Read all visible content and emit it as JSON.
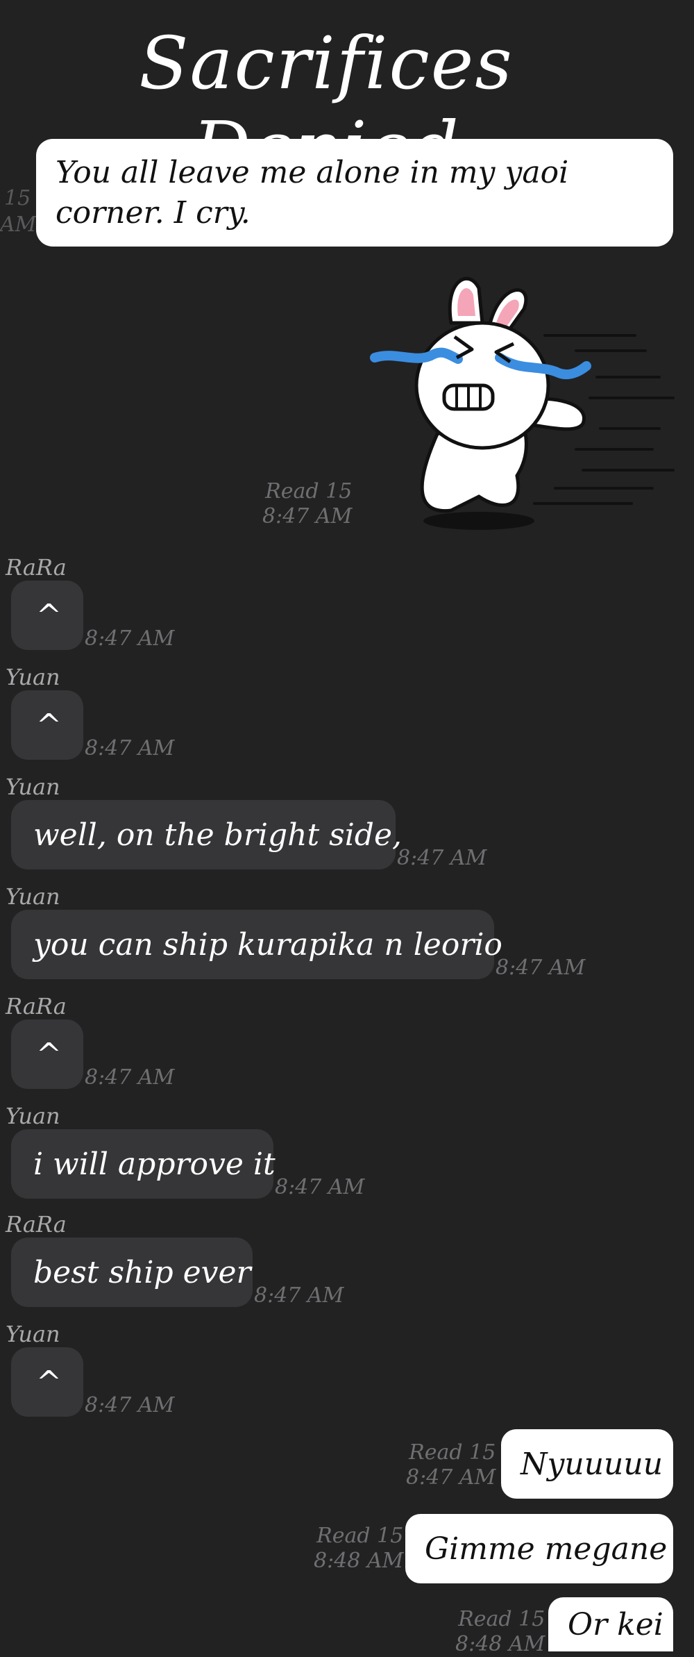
{
  "title": "Sacrifices Denied",
  "top_message": {
    "line1": "You all leave me alone in my yaoi",
    "line2": "corner. I cry.",
    "time_fragment_1": "15",
    "time_fragment_2": "AM"
  },
  "sticker": {
    "read_label": "Read 15",
    "time": "8:47 AM"
  },
  "messages": [
    {
      "sender": "RaRa",
      "text": "^",
      "time": "8:47 AM"
    },
    {
      "sender": "Yuan",
      "text": "^",
      "time": "8:47 AM"
    },
    {
      "sender": "Yuan",
      "text": "well, on the bright side,",
      "time": "8:47 AM"
    },
    {
      "sender": "Yuan",
      "text": "you can ship kurapika n leorio",
      "time": "8:47 AM"
    },
    {
      "sender": "RaRa",
      "text": "^",
      "time": "8:47 AM"
    },
    {
      "sender": "Yuan",
      "text": "i will approve it",
      "time": "8:47 AM"
    },
    {
      "sender": "RaRa",
      "text": "best ship ever",
      "time": "8:47 AM"
    },
    {
      "sender": "Yuan",
      "text": "^",
      "time": "8:47 AM"
    }
  ],
  "outgoing": [
    {
      "text": "Nyuuuuu",
      "read": "Read 15",
      "time": "8:47 AM"
    },
    {
      "text": "Gimme megane",
      "read": "Read 15",
      "time": "8:48 AM"
    },
    {
      "text": "Or kei",
      "read": "Read 15",
      "time": "8:48 AM"
    }
  ]
}
